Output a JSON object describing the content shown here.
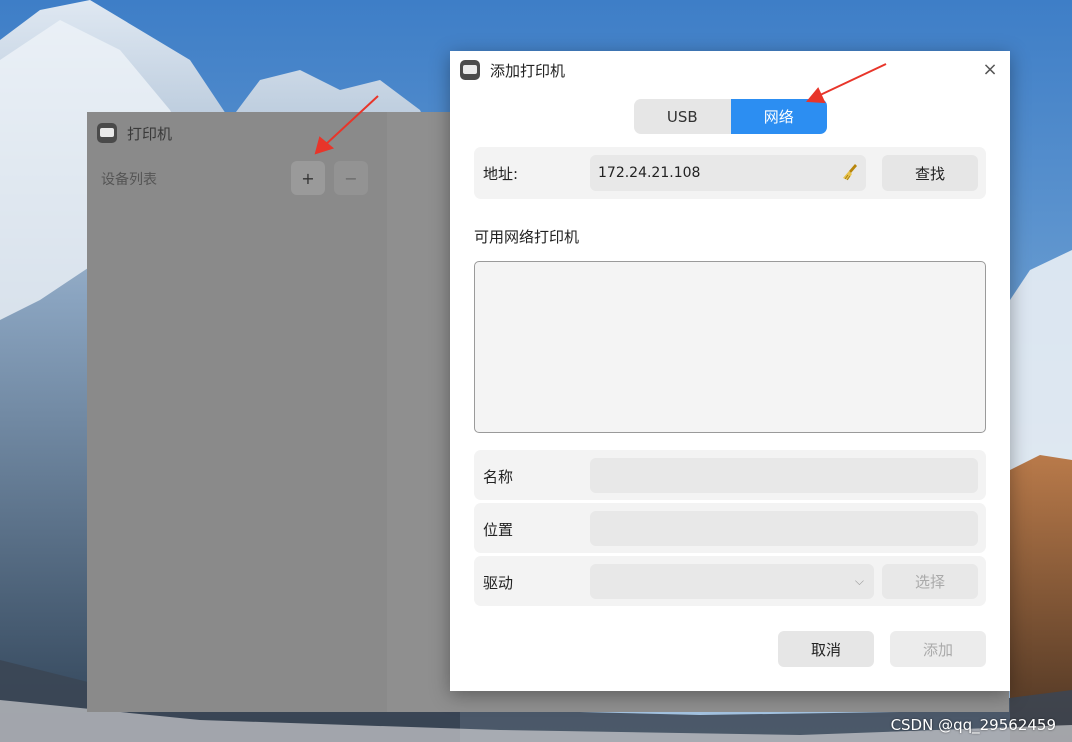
{
  "background_window": {
    "title": "打印机",
    "devices_label": "设备列表",
    "add_symbol": "+",
    "remove_symbol": "−"
  },
  "dialog": {
    "title": "添加打印机",
    "close_symbol": "×",
    "tabs": [
      {
        "label": "USB",
        "selected": false
      },
      {
        "label": "网络",
        "selected": true
      }
    ],
    "address": {
      "label": "地址:",
      "value": "172.24.21.108",
      "find_label": "查找"
    },
    "available_label": "可用网络打印机",
    "form": {
      "name_label": "名称",
      "name_value": "",
      "location_label": "位置",
      "location_value": "",
      "driver_label": "驱动",
      "driver_value": "",
      "select_label": "选择"
    },
    "cancel_label": "取消",
    "add_label": "添加"
  },
  "watermark": "CSDN @qq_29562459",
  "colors": {
    "accent": "#2c8ef2",
    "annotation_arrow": "#e8352a"
  },
  "icons": [
    "printer-app-icon",
    "close-icon",
    "broom-clear-icon",
    "chevron-down-icon",
    "plus-icon",
    "minus-icon"
  ]
}
